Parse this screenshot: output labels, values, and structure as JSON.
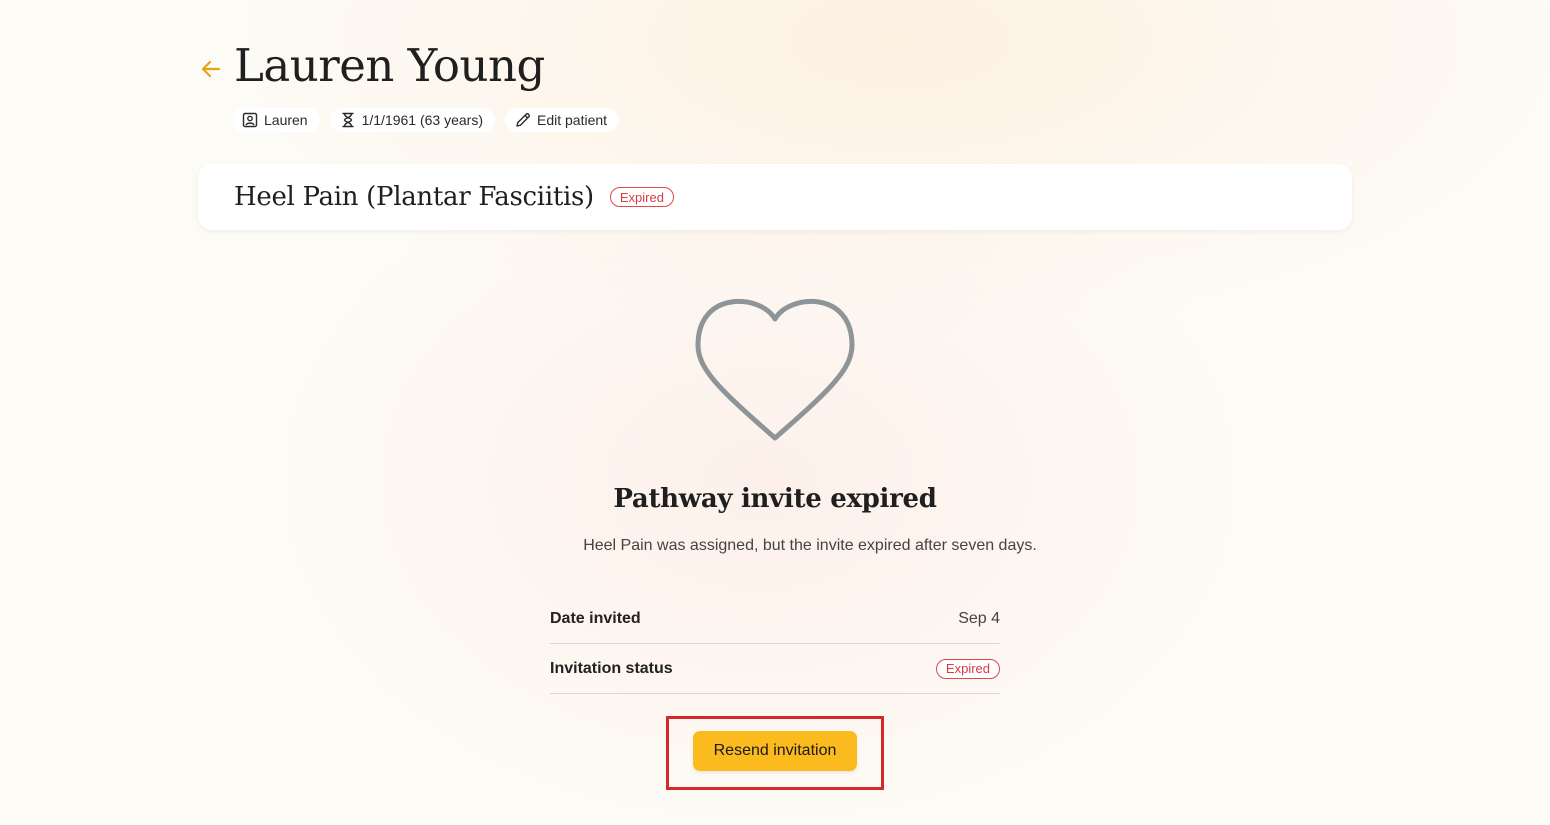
{
  "patient": {
    "name": "Lauren Young",
    "chips": {
      "first_name": "Lauren",
      "dob": "1/1/1961 (63 years)",
      "edit": "Edit patient"
    }
  },
  "pathway": {
    "title": "Heel Pain (Plantar Fasciitis)",
    "status_badge": "Expired"
  },
  "empty_state": {
    "icon": "heart-icon",
    "title": "Pathway invite expired",
    "description": "Heel Pain was assigned, but the invite expired after seven days."
  },
  "details": {
    "date_invited_label": "Date invited",
    "date_invited_value": "Sep 4",
    "invitation_status_label": "Invitation status",
    "invitation_status_value": "Expired"
  },
  "actions": {
    "resend_label": "Resend invitation"
  },
  "colors": {
    "accent": "#fbbb1f",
    "back_arrow": "#e5a316",
    "expired": "#d63c42",
    "heart_stroke": "#8d9598"
  }
}
